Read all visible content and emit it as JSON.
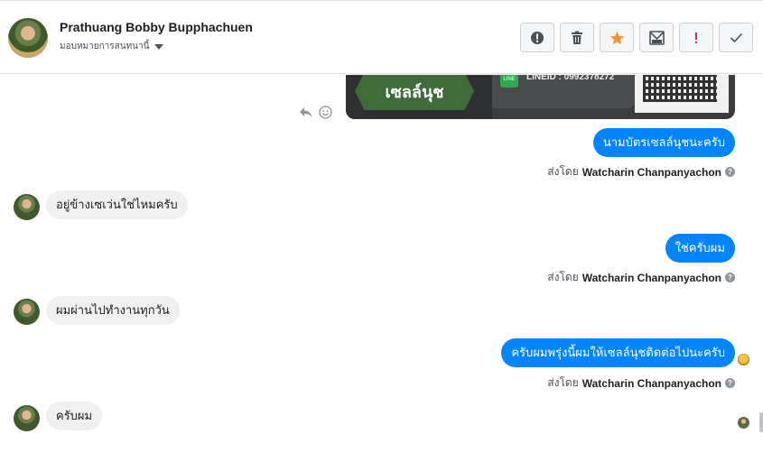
{
  "header": {
    "contact_name": "Prathuang Bobby Bupphachuen",
    "assign_label": "มอบหมายการสนทนานี้"
  },
  "toolbar": {
    "buttons": [
      {
        "name": "mark-spam-button",
        "icon": "alert-circle-icon",
        "color": "#4b4f56"
      },
      {
        "name": "delete-button",
        "icon": "trash-icon",
        "color": "#4b4f56"
      },
      {
        "name": "star-button",
        "icon": "star-icon",
        "color": "#f7923b"
      },
      {
        "name": "archive-button",
        "icon": "archive-box-icon",
        "color": "#4b4f56"
      },
      {
        "name": "follow-up-button",
        "icon": "exclamation-icon",
        "color": "#e0245e"
      },
      {
        "name": "mark-done-button",
        "icon": "checkmark-icon",
        "color": "#4b4f56"
      }
    ]
  },
  "card": {
    "label": "เซลล์นุช",
    "line_id": "LINEID : 0992378272",
    "line_badge": "LINE"
  },
  "messages": [
    {
      "dir": "out",
      "text": "นามบัตรเซลล์นุชนะครับ",
      "sent_by_prefix": "ส่งโดย",
      "sent_by": "Watcharin Chanpanyachon"
    },
    {
      "dir": "in",
      "text": "อยู่ข้างเซเว่นใช่ไหมครับ"
    },
    {
      "dir": "out",
      "text": "ใช่ครับผม",
      "sent_by_prefix": "ส่งโดย",
      "sent_by": "Watcharin Chanpanyachon"
    },
    {
      "dir": "in",
      "text": "ผมผ่านไปทำงานทุกวัน"
    },
    {
      "dir": "out",
      "text": "ครับผมพรุ่งนี้ผมให้เซลล์นุชติดต่อไปนะครับ",
      "sent_by_prefix": "ส่งโดย",
      "sent_by": "Watcharin Chanpanyachon"
    },
    {
      "dir": "in",
      "text": "ครับผม"
    }
  ],
  "colors": {
    "accent": "#0084ff",
    "incoming_bubble": "#f1f0f0",
    "star": "#f7923b",
    "alert": "#e0245e"
  }
}
